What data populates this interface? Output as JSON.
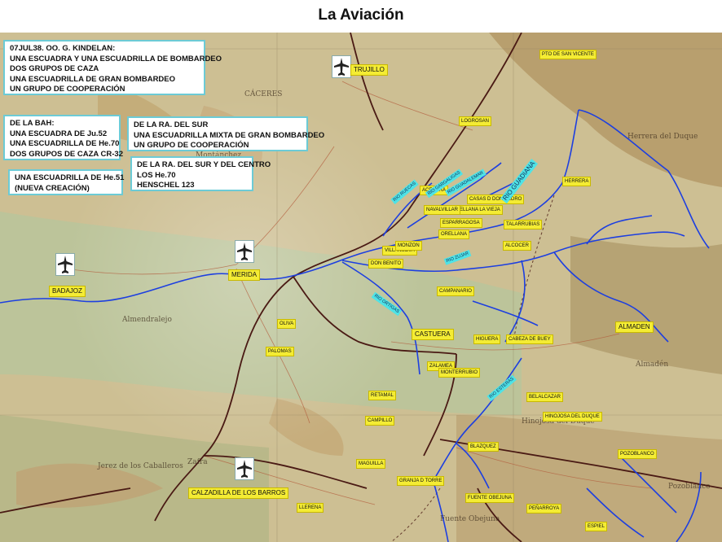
{
  "title": "La Aviación",
  "boxes": {
    "kindelan": [
      "07JUL38. OO. G. KINDELAN:",
      "UNA ESCUADRA Y UNA ESCUADRILLA DE BOMBARDEO",
      "DOS GRUPOS DE CAZA",
      "UNA ESCUADRILLA DE GRAN BOMBARDEO",
      "UN GRUPO DE COOPERACIÓN"
    ],
    "bah": [
      "DE LA BAH:",
      "UNA ESCUADRA DE Ju.52",
      "UNA ESCUADRILLA DE He.70",
      "DOS GRUPOS DE CAZA CR-32"
    ],
    "he51": [
      "UNA ESCUADRILLA DE  He.51",
      "(NUEVA CREACIÓN)"
    ],
    "sur": [
      "DE LA RA. DEL SUR",
      "UNA ESCUADRILLA MIXTA DE GRAN BOMBARDEO",
      "UN GRUPO DE COOPERACIÓN"
    ],
    "centro": [
      "DE LA RA. DEL SUR Y DEL CENTRO",
      "LOS He.70",
      "HENSCHEL 123"
    ]
  },
  "towns": {
    "trujillo": "TRUJILLO",
    "badajoz": "BADAJOZ",
    "merida": "MERIDA",
    "calzadilla": "CALZADILLA DE LOS BARROS",
    "castuera": "CASTUERA",
    "almaden": "ALMADEN",
    "pto_san_vicente": "PTO DE SAN VICENTE",
    "logrosan": "LOGROSAN",
    "herrera": "HERRERA",
    "casas_don_pedro": "CASAS D DON PEDRO",
    "orellana": "ORELLANA",
    "talarrubias": "TALARRUBIAS",
    "alcocer": "ALCOCER",
    "villanueva": "VILLANUEVA",
    "don_benito": "DON BENITO",
    "campanario": "CAMPANARIO",
    "oliva": "OLIVA",
    "palomas": "PALOMAS",
    "retamal": "RETAMAL",
    "campillo": "CAMPILLO",
    "zalamea": "ZALAMEA",
    "monterrubio": "MONTERRUBIO",
    "higuera": "HIGUERA",
    "cabeza_buey": "CABEZA DE BUEY",
    "belalcazar": "BELALCAZAR",
    "hinojosa": "HINOJOSA DEL DUQUE",
    "blazquez": "BLAZQUEZ",
    "pozoblanco": "POZOBLANCO",
    "maguilla": "MAGUILLA",
    "granja_torre": "GRANJA D TORRE",
    "llerena": "LLERENA",
    "fuente_obejuna": "FUENTE OBEJUNA",
    "penarroya": "PEÑARROYA",
    "espiel": "ESPIEL",
    "esparragosa": "ESPARRAGOSA",
    "acedera": "ACEDERA",
    "orellana_v": "ORELLANA LA VIEJA",
    "navalvillar": "NAVALVILLAR",
    "monzon": "MONZON"
  },
  "rivers": {
    "guadiana": "RIO GUADIANA",
    "zujar": "RIO ZUJAR",
    "ortigas": "RIO ORTIGAS",
    "ruecas": "RIO RUECAS",
    "gargaligas": "RIO GARGALIGAS",
    "guadalemar": "RIO GUADALEMAR",
    "esteras": "RIO ESTERAS"
  },
  "colors": {
    "box_border": "#6ccbd6",
    "town_label": "#f4ec34",
    "river_label": "#4fe3e6",
    "river": "#1d3fe0",
    "railway": "#4a1a14"
  },
  "icons": [
    "airplane-icon"
  ]
}
